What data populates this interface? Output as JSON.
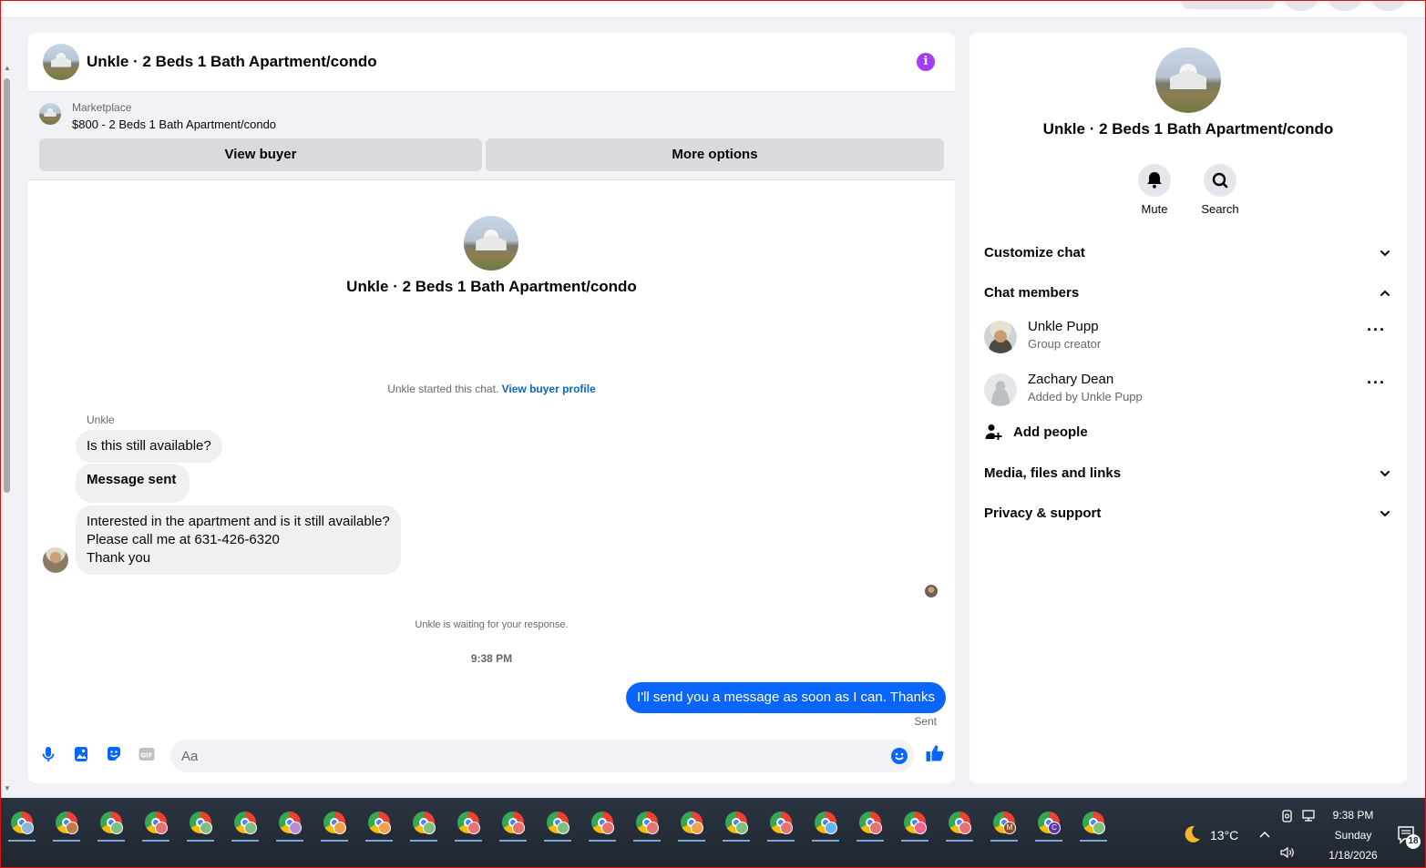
{
  "chat": {
    "title": "Unkle · 2 Beds 1 Bath Apartment/condo",
    "marketplace_label": "Marketplace",
    "marketplace_item": "$800 - 2 Beds 1 Bath Apartment/condo",
    "view_buyer": "View buyer",
    "more_options": "More options"
  },
  "thread": {
    "title": "Unkle · 2 Beds 1 Bath Apartment/condo",
    "started_text": "Unkle started this chat.",
    "started_link": "View buyer profile",
    "sender": "Unkle",
    "messages_in": [
      "Is this still available?",
      "Message sent",
      "Interested in the apartment and is it still available?",
      "Please call me at 631-426-6320",
      "Thank you"
    ],
    "waiting": "Unkle is waiting for your response.",
    "time": "9:38 PM",
    "message_out": "I'll send you a message as soon as I can. Thanks",
    "status": "Sent"
  },
  "composer": {
    "placeholder": "Aa",
    "icons": [
      "microphone-icon",
      "photo-icon",
      "sticker-icon",
      "gif-icon",
      "emoji-icon",
      "thumbs-up-icon"
    ]
  },
  "info": {
    "title": "Unkle · 2 Beds 1 Bath Apartment/condo",
    "mute": "Mute",
    "search": "Search",
    "sections": {
      "customize": "Customize chat",
      "members": "Chat members",
      "media": "Media, files and links",
      "privacy": "Privacy & support"
    },
    "members": [
      {
        "name": "Unkle Pupp",
        "sub": "Group creator"
      },
      {
        "name": "Zachary Dean",
        "sub": "Added by Unkle Pupp"
      }
    ],
    "add_people": "Add people"
  },
  "taskbar": {
    "weather": "13°C",
    "time": "9:38 PM",
    "day": "Sunday",
    "date": "1/18/2026",
    "notifications": "18",
    "profile_colors": [
      "#8fb4d9",
      "#c47a4a",
      "#7fbf7f",
      "#e57373",
      "#7fbf7f",
      "#7fbf7f",
      "#b58ad6",
      "#f0a050",
      "#f0a050",
      "#7fbf7f",
      "#e57373",
      "#e57373",
      "#7fbf7f",
      "#e57373",
      "#e57373",
      "#f0a050",
      "#7fbf7f",
      "#e57373",
      "#64b5f6",
      "#e57373",
      "#f06292",
      "#e57373",
      "#8d4a2a",
      "#5c35a8",
      "#7fbf7f"
    ],
    "profile_letters": [
      "",
      "",
      "",
      "",
      "",
      "",
      "",
      "",
      "",
      "",
      "",
      "",
      "",
      "",
      "",
      "",
      "",
      "",
      "",
      "",
      "",
      "",
      "M",
      "C",
      ""
    ]
  },
  "colors": {
    "accent_blue": "#0866ff",
    "info_purple": "#a33df5",
    "link_blue": "#0a66c2"
  }
}
